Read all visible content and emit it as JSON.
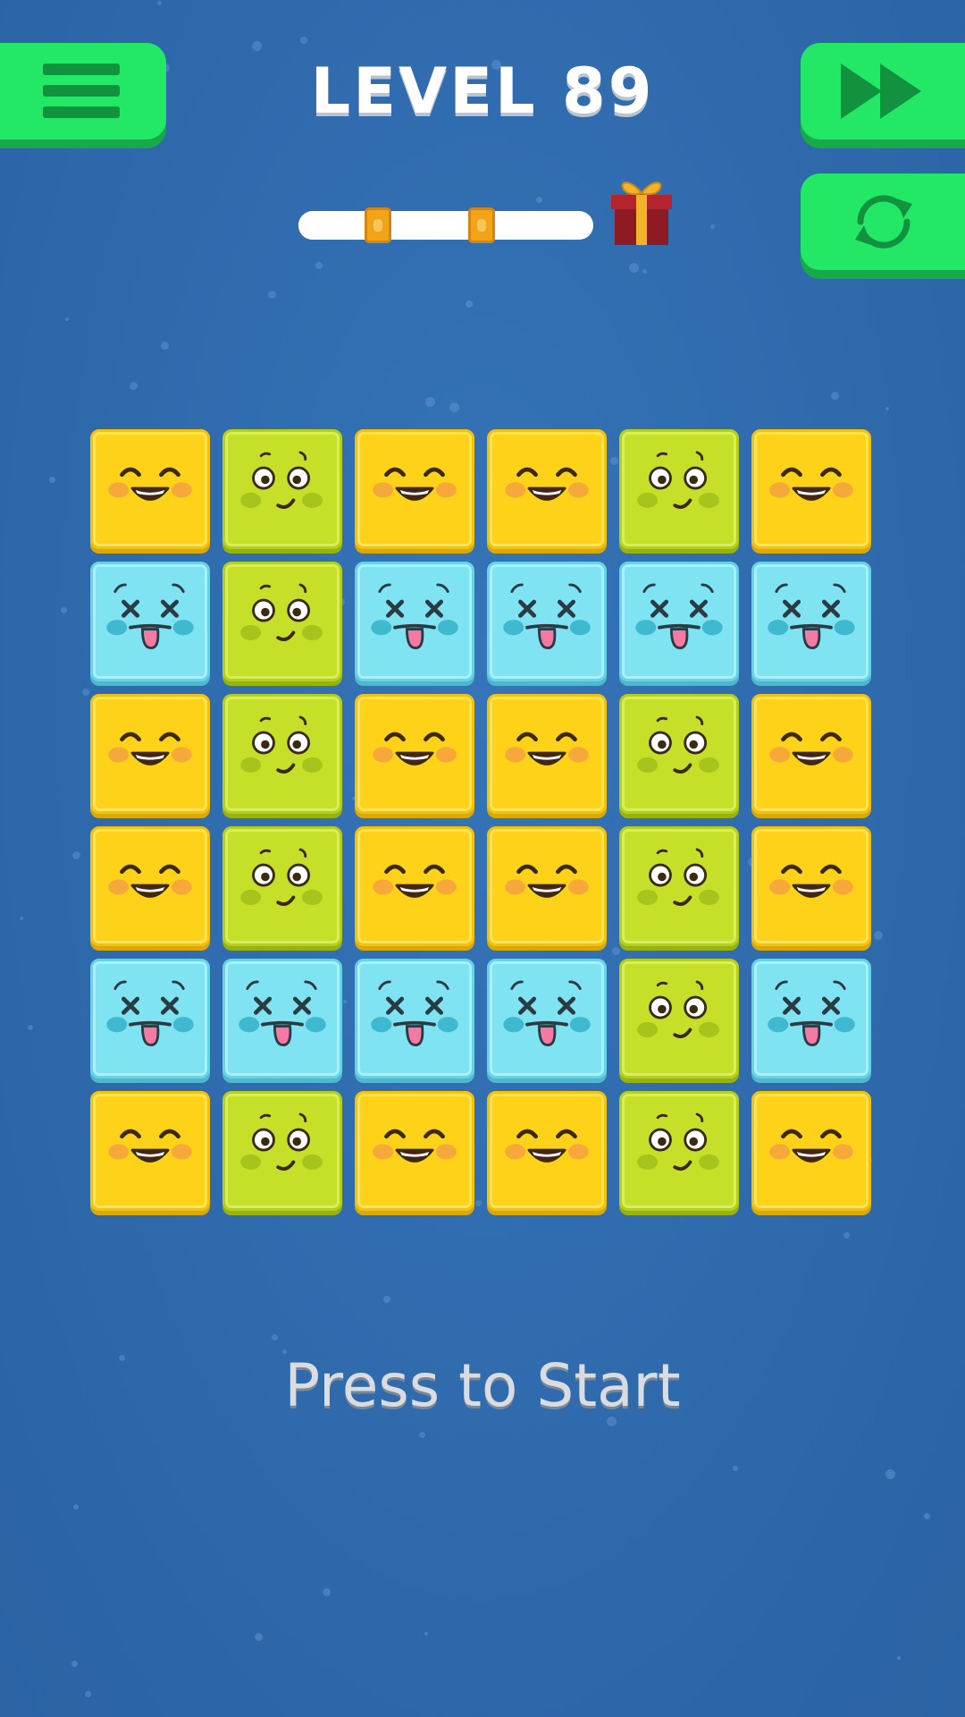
{
  "header": {
    "level_title": "LEVEL 89",
    "progress": 0.88,
    "star_thresholds": [
      0.27,
      0.62
    ]
  },
  "buttons": {
    "menu_icon": "hamburger-menu-icon",
    "skip_icon": "fast-forward-icon",
    "restart_icon": "refresh-arrows-icon"
  },
  "board": {
    "rows": 6,
    "cols": 6,
    "tiles": [
      [
        "happy",
        "surprised",
        "happy",
        "happy",
        "surprised",
        "happy"
      ],
      [
        "dizzy",
        "surprised",
        "dizzy",
        "dizzy",
        "dizzy",
        "dizzy"
      ],
      [
        "happy",
        "surprised",
        "happy",
        "happy",
        "surprised",
        "happy"
      ],
      [
        "happy",
        "surprised",
        "happy",
        "happy",
        "surprised",
        "happy"
      ],
      [
        "dizzy",
        "dizzy",
        "dizzy",
        "dizzy",
        "surprised",
        "dizzy"
      ],
      [
        "happy",
        "surprised",
        "happy",
        "happy",
        "surprised",
        "happy"
      ]
    ],
    "tile_colors": {
      "happy": "#ffd21a",
      "surprised": "#c6e02a",
      "dizzy": "#7fe3f2"
    }
  },
  "footer": {
    "start_prompt": "Press to Start"
  },
  "colors": {
    "background": "#2f6db0",
    "button": "#22e866",
    "button_shadow": "#17a94a"
  }
}
